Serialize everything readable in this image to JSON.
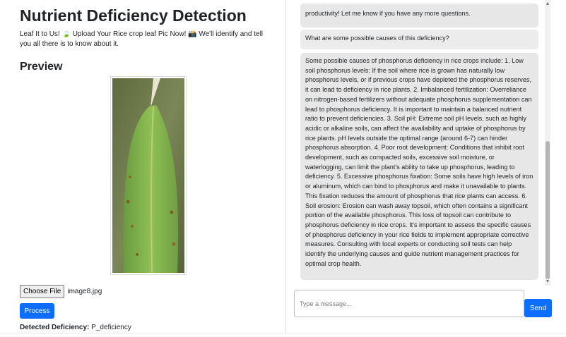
{
  "header": {
    "title": "Nutrient Deficiency Detection",
    "subtitle": "Leaf It to Us! 🍃 Upload Your Rice crop leaf Pic Now! 📸 We'll identify and tell you all there is to know about it."
  },
  "preview": {
    "heading": "Preview"
  },
  "file": {
    "button_label": "Choose File",
    "file_name": "image8.jpg"
  },
  "process": {
    "label": "Process"
  },
  "result": {
    "label": "Detected Deficiency:",
    "value": "P_deficiency"
  },
  "chat": {
    "messages": [
      {
        "role": "bot",
        "text": "productivity! Let me know if you have any more questions."
      },
      {
        "role": "user",
        "text": "What are some possible causes of this deficiency?"
      },
      {
        "role": "bot",
        "text": "Some possible causes of phosphorus deficiency in rice crops include: 1. Low soil phosphorus levels: If the soil where rice is grown has naturally low phosphorus levels, or if previous crops have depleted the phosphorus reserves, it can lead to deficiency in rice plants. 2. Imbalanced fertilization: Overreliance on nitrogen-based fertilizers without adequate phosphorus supplementation can lead to phosphorus deficiency. It is important to maintain a balanced nutrient ratio to prevent deficiencies. 3. Soil pH: Extreme soil pH levels, such as highly acidic or alkaline soils, can affect the availability and uptake of phosphorus by rice plants. pH levels outside the optimal range (around 6-7) can hinder phosphorus absorption. 4. Poor root development: Conditions that inhibit root development, such as compacted soils, excessive soil moisture, or waterlogging, can limit the plant's ability to take up phosphorus, leading to deficiency. 5. Excessive phosphorus fixation: Some soils have high levels of iron or aluminum, which can bind to phosphorus and make it unavailable to plants. This fixation reduces the amount of phosphorus that rice plants can access. 6. Soil erosion: Erosion can wash away topsoil, which often contains a significant portion of the available phosphorus. This loss of topsoil can contribute to phosphorus deficiency in rice crops. It's important to assess the specific causes of phosphorus deficiency in your rice fields to implement appropriate corrective measures. Consulting with local experts or conducting soil tests can help identify the underlying causes and guide nutrient management practices for optimal crop health."
      }
    ],
    "input_placeholder": "Type a message...",
    "send_label": "Send"
  }
}
